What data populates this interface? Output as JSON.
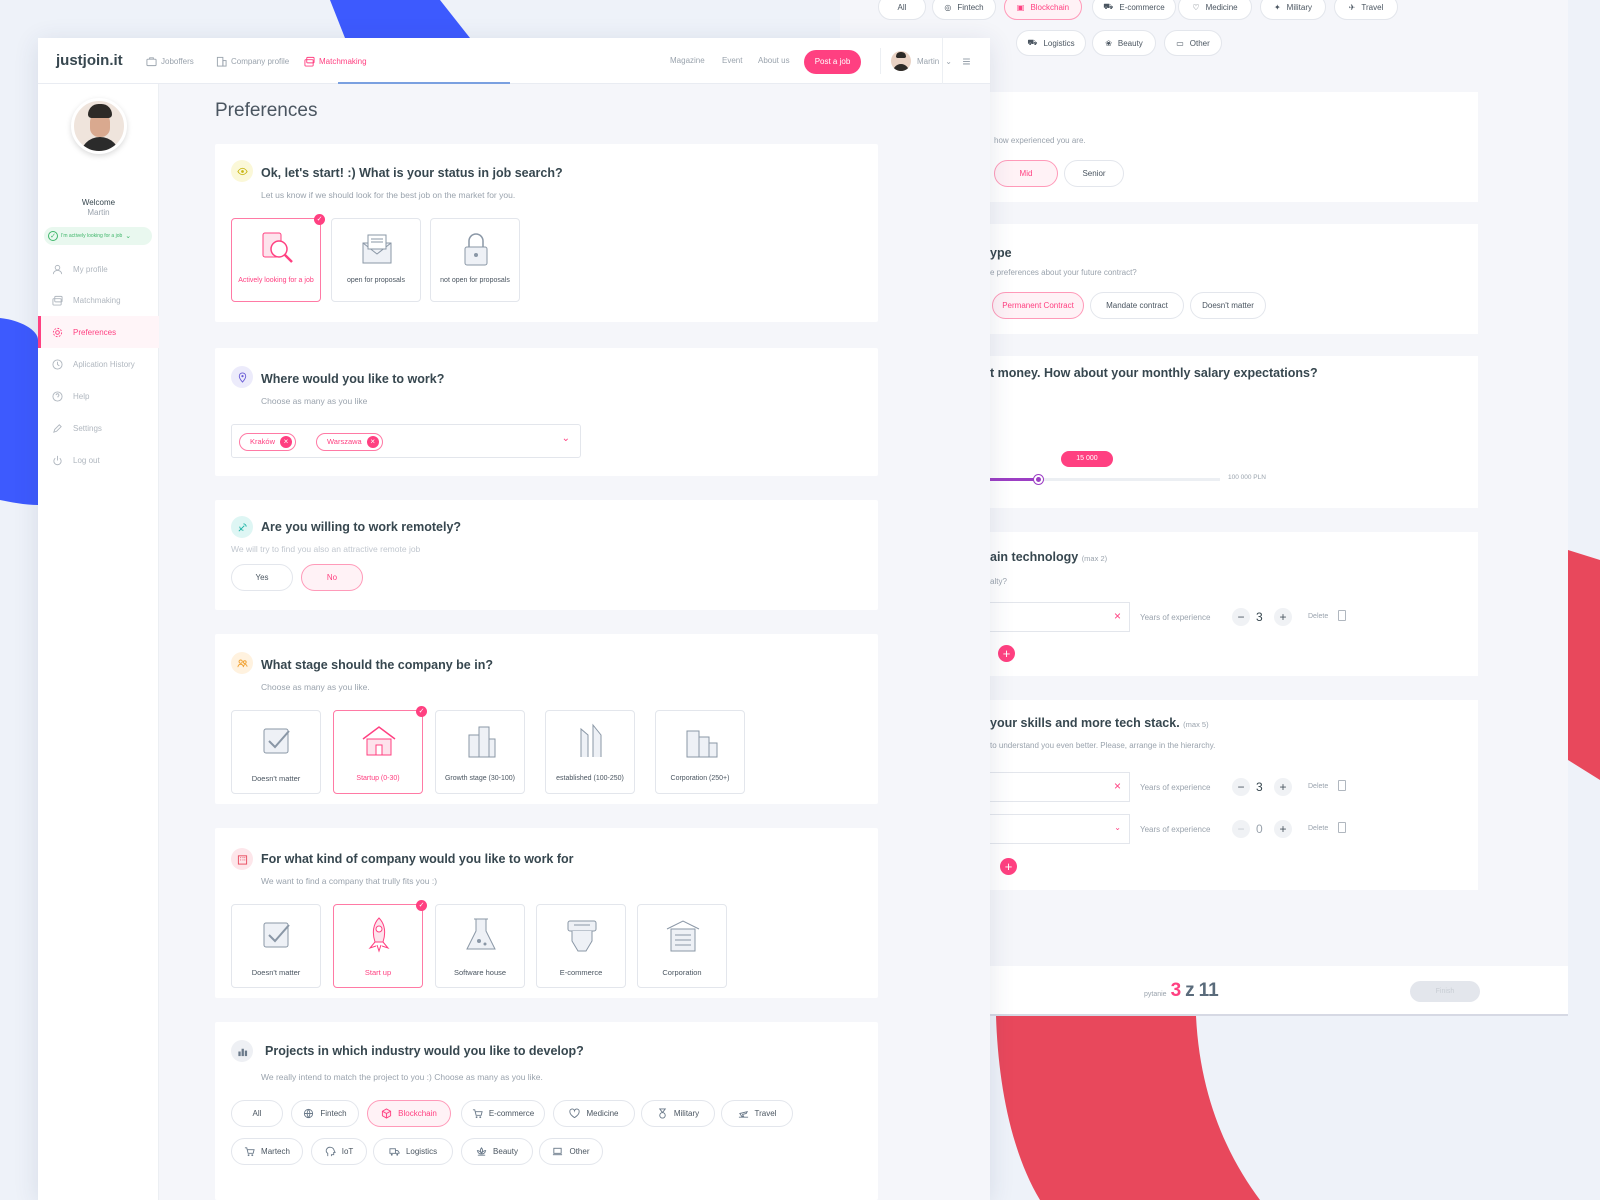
{
  "colors": {
    "accent": "#ff4081",
    "brand_blue": "#3d5afe",
    "deco_red": "#e8485c",
    "success": "#3fb66a"
  },
  "topbar": {
    "logo": "justjoin.it",
    "nav": [
      {
        "label": "Joboffers",
        "icon": "briefcase-icon"
      },
      {
        "label": "Company profile",
        "icon": "building-icon"
      },
      {
        "label": "Matchmaking",
        "icon": "matchmaking-icon",
        "active": true
      }
    ],
    "links": [
      "Magazine",
      "Event",
      "About us"
    ],
    "post_job": "Post a job",
    "user_name": "Martin"
  },
  "sidebar": {
    "welcome": "Welcome",
    "name": "Martin",
    "status": "I'm actively looking for a job",
    "items": [
      {
        "label": "My profile",
        "icon": "user-icon"
      },
      {
        "label": "Matchmaking",
        "icon": "matchmaking-icon"
      },
      {
        "label": "Preferences",
        "icon": "gear-icon",
        "active": true
      },
      {
        "label": "Aplication History",
        "icon": "clock-icon"
      },
      {
        "label": "Help",
        "icon": "help-icon"
      },
      {
        "label": "Settings",
        "icon": "pencil-icon"
      },
      {
        "label": "Log out",
        "icon": "power-icon"
      }
    ]
  },
  "page_title": "Preferences",
  "q1": {
    "title": "Ok, let's start! :) What is your status in job search?",
    "subtitle": "Let us know if we should look for the best job on the market for you.",
    "options": [
      {
        "label": "Actively looking for a job",
        "selected": true
      },
      {
        "label": "open for proposals"
      },
      {
        "label": "not open for proposals"
      }
    ]
  },
  "q2": {
    "title": "Where would you like to work?",
    "subtitle": "Choose as many as you like",
    "chips": [
      "Kraków",
      "Warszawa"
    ]
  },
  "q3": {
    "title": "Are you willing to work remotely?",
    "subtitle": "We will try to find you also an attractive remote job",
    "options": [
      "Yes",
      "No"
    ],
    "selected": "No"
  },
  "q4": {
    "title": "What stage should the company be in?",
    "subtitle": "Choose as many as you like.",
    "options": [
      {
        "label": "Doesn't matter"
      },
      {
        "label": "Startup (0-30)",
        "selected": true
      },
      {
        "label": "Growth stage (30-100)"
      },
      {
        "label": "established (100-250)"
      },
      {
        "label": "Corporation (250+)"
      }
    ]
  },
  "q5": {
    "title": "For what kind of company would you like to work for",
    "subtitle": "We want to find a company that trully fits you :)",
    "options": [
      {
        "label": "Doesn't matter"
      },
      {
        "label": "Start up",
        "selected": true
      },
      {
        "label": "Software house"
      },
      {
        "label": "E-commerce"
      },
      {
        "label": "Corporation"
      }
    ]
  },
  "q6": {
    "title": "Projects in which industry would you like to develop?",
    "subtitle": "We really intend to match the project to you :) Choose as many as you like.",
    "row1": [
      "All",
      "Fintech",
      "Blockchain",
      "E-commerce",
      "Medicine",
      "Military",
      "Travel"
    ],
    "row2": [
      "Martech",
      "IoT",
      "Logistics",
      "Beauty",
      "Other"
    ],
    "selected": "Blockchain"
  },
  "back": {
    "top_tags_row1": [
      "All",
      "Fintech",
      "Blockchain",
      "E-commerce",
      "Medicine",
      "Military",
      "Travel"
    ],
    "top_tags_row2": [
      "Logistics",
      "Beauty",
      "Other"
    ],
    "exp_sub": "how experienced you are.",
    "exp_options": [
      "Mid",
      "Senior"
    ],
    "contract_title": "ype",
    "contract_sub": "e preferences about your future contract?",
    "contract_options": [
      "Permanent Contract",
      "Mandate contract",
      "Doesn't matter"
    ],
    "salary_title": "t money. How about your monthly salary expectations?",
    "salary_value": "15 000",
    "salary_max": "100 000 PLN",
    "salary_fraction": 0.5,
    "tech_title": "ain technology",
    "tech_max": "(max 2)",
    "tech_sub": "alty?",
    "years_label": "Years of experience",
    "delete_label": "Delete",
    "tech_years": "3",
    "skills_title": "your skills and more tech stack.",
    "skills_max": "(max 5)",
    "skills_sub": "to understand you even better. Please, arrange in the hierarchy.",
    "skills_years": [
      "3",
      "0"
    ],
    "pager_label": "pytanie",
    "pager_current": "3",
    "pager_sep": "z",
    "pager_total": "11",
    "finish": "Finish"
  }
}
